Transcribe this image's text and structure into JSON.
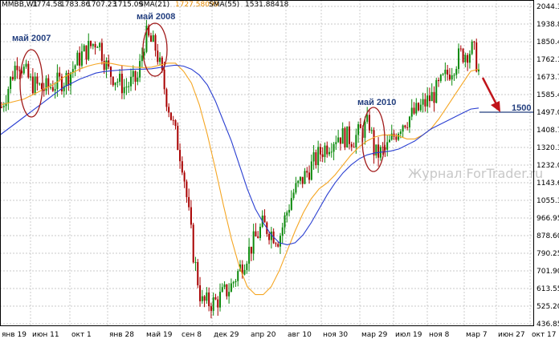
{
  "chart_data": {
    "type": "candlestick",
    "header": {
      "symbol": "MMBB,W1",
      "ohlc": [
        "1774.58",
        "1783.86",
        "1707.23",
        "1715.09"
      ],
      "sma_fast_label": "SMA(21)",
      "sma_fast_value": "1727.58099",
      "sma_slow_label": "SMA(55)",
      "sma_slow_value": "1531.88418"
    },
    "y_ticks": [
      "2044.30",
      "1938.80",
      "1850.45",
      "1762.10",
      "1673.75",
      "1585.40",
      "1497.05",
      "1408.70",
      "1320.35",
      "1232.00",
      "1143.65",
      "1055.30",
      "966.95",
      "878.60",
      "790.25",
      "701.90",
      "613.55",
      "525.20",
      "436.85"
    ],
    "ylim": [
      436.85,
      2044.3
    ],
    "x_ticks": [
      "янв 19",
      "июн 11",
      "окт 1",
      "янв 28",
      "май 19",
      "сен 8",
      "дек 29",
      "апр 20",
      "авг 10",
      "ноя 30",
      "мар 29",
      "июл 19",
      "ноя 8",
      "мар 7",
      "июн 27",
      "окт 17"
    ],
    "annotations": [
      {
        "text": "май 2007"
      },
      {
        "text": "май 2008"
      },
      {
        "text": "май 2010"
      },
      {
        "text": "1500",
        "value": 1500
      }
    ],
    "watermark": "Журнал ForTrader.ru",
    "colors": {
      "up": "#0c8a0c",
      "down": "#a80000",
      "sma_fast": "#f5a623",
      "sma_slow": "#2a3fd1",
      "ellipse": "#a01818",
      "annotation": "#233f7f",
      "arrow": "#c0141a",
      "grid": "#b8b8b8"
    },
    "series": [
      {
        "name": "SMA(21)",
        "values": [
          1550,
          1560,
          1570,
          1580,
          1600,
          1620,
          1640,
          1660,
          1690,
          1710,
          1730,
          1745,
          1755,
          1762,
          1758,
          1750,
          1745,
          1740,
          1738,
          1740,
          1750,
          1760,
          1760,
          1720,
          1660,
          1550,
          1400,
          1230,
          1050,
          880,
          740,
          640,
          600,
          600,
          640,
          720,
          820,
          920,
          1010,
          1080,
          1130,
          1160,
          1200,
          1250,
          1300,
          1340,
          1370,
          1390,
          1400,
          1400,
          1395,
          1380,
          1380,
          1400,
          1430,
          1480,
          1540,
          1600,
          1660,
          1720,
          1730
        ]
      },
      {
        "name": "SMA(55)",
        "values": [
          1400,
          1430,
          1460,
          1490,
          1520,
          1550,
          1580,
          1610,
          1640,
          1660,
          1680,
          1695,
          1710,
          1718,
          1722,
          1725,
          1728,
          1730,
          1730,
          1732,
          1738,
          1745,
          1750,
          1745,
          1730,
          1700,
          1650,
          1570,
          1470,
          1370,
          1250,
          1130,
          1030,
          960,
          900,
          860,
          850,
          860,
          900,
          960,
          1030,
          1100,
          1160,
          1210,
          1250,
          1280,
          1300,
          1310,
          1315,
          1320,
          1330,
          1350,
          1370,
          1400,
          1430,
          1450,
          1470,
          1490,
          1510,
          1530,
          1535
        ]
      }
    ]
  }
}
